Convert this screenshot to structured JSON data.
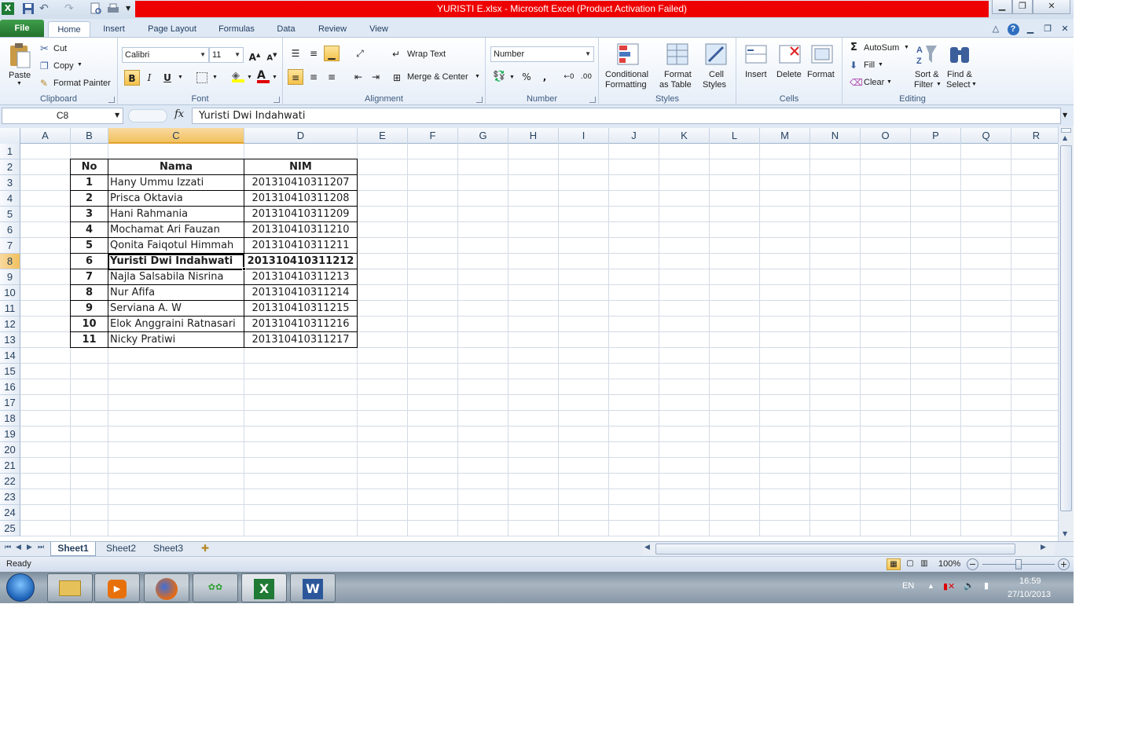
{
  "window": {
    "title": "YURISTI E.xlsx  -  Microsoft Excel (Product Activation Failed)"
  },
  "tabs": [
    "File",
    "Home",
    "Insert",
    "Page Layout",
    "Formulas",
    "Data",
    "Review",
    "View"
  ],
  "ribbon": {
    "clipboard": {
      "paste": "Paste",
      "cut": "Cut",
      "copy": "Copy",
      "format_painter": "Format Painter",
      "label": "Clipboard"
    },
    "font": {
      "name": "Calibri",
      "size": "11",
      "bold": "B",
      "italic": "I",
      "underline": "U",
      "label": "Font"
    },
    "alignment": {
      "wrap": "Wrap Text",
      "merge": "Merge & Center",
      "label": "Alignment"
    },
    "number": {
      "format": "Number",
      "percent": "%",
      "comma": ",",
      "label": "Number"
    },
    "styles": {
      "cond1": "Conditional",
      "cond2": "Formatting",
      "fmt1": "Format",
      "fmt2": "as Table",
      "cell1": "Cell",
      "cell2": "Styles",
      "label": "Styles"
    },
    "cells": {
      "insert": "Insert",
      "delete": "Delete",
      "format": "Format",
      "label": "Cells"
    },
    "editing": {
      "autosum": "AutoSum",
      "fill": "Fill",
      "clear": "Clear",
      "sort1": "Sort &",
      "sort2": "Filter",
      "find1": "Find &",
      "find2": "Select",
      "label": "Editing"
    }
  },
  "formula_bar": {
    "name_box": "C8",
    "fx": "fx",
    "formula": "Yuristi Dwi Indahwati"
  },
  "columns": [
    "A",
    "B",
    "C",
    "D",
    "E",
    "F",
    "G",
    "H",
    "I",
    "J",
    "K",
    "L",
    "M",
    "N",
    "O",
    "P",
    "Q",
    "R"
  ],
  "rows": [
    "1",
    "2",
    "3",
    "4",
    "5",
    "6",
    "7",
    "8",
    "9",
    "10",
    "11",
    "12",
    "13",
    "14",
    "15",
    "16",
    "17",
    "18",
    "19",
    "20",
    "21",
    "22",
    "23",
    "24",
    "25"
  ],
  "selected_cell": {
    "column": "C",
    "row": "8"
  },
  "table": {
    "headers": [
      "No",
      "Nama",
      "NIM"
    ],
    "rows": [
      [
        "1",
        "Hany Ummu Izzati",
        "201310410311207"
      ],
      [
        "2",
        "Prisca Oktavia",
        "201310410311208"
      ],
      [
        "3",
        "Hani Rahmania",
        "201310410311209"
      ],
      [
        "4",
        "Mochamat Ari Fauzan",
        "201310410311210"
      ],
      [
        "5",
        "Qonita Faiqotul Himmah",
        "201310410311211"
      ],
      [
        "6",
        "Yuristi Dwi Indahwati",
        "201310410311212"
      ],
      [
        "7",
        "Najla Salsabila Nisrina",
        "201310410311213"
      ],
      [
        "8",
        "Nur Afifa",
        "201310410311214"
      ],
      [
        "9",
        "Serviana A. W",
        "201310410311215"
      ],
      [
        "10",
        "Elok Anggraini Ratnasari",
        "201310410311216"
      ],
      [
        "11",
        "Nicky Pratiwi",
        "201310410311217"
      ]
    ]
  },
  "sheets": [
    "Sheet1",
    "Sheet2",
    "Sheet3"
  ],
  "active_sheet": "Sheet1",
  "status": {
    "ready": "Ready",
    "zoom": "100%"
  },
  "taskbar": {
    "lang": "EN",
    "time": "16:59",
    "date": "27/10/2013"
  },
  "colors": {
    "title_alert": "#ee0000",
    "file_tab": "#2e7f3a",
    "selection": "#f1c15f"
  }
}
